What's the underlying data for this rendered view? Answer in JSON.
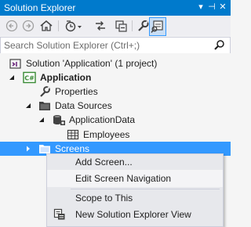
{
  "window": {
    "title": "Solution Explorer",
    "controls": [
      "▾",
      "⊣",
      "✕"
    ]
  },
  "toolbar": {
    "buttons": [
      "back-icon",
      "forward-icon",
      "home-icon",
      "history-icon",
      "sync-icon",
      "properties-icon",
      "preview-icon"
    ]
  },
  "search": {
    "placeholder": "Search Solution Explorer (Ctrl+;)"
  },
  "tree": {
    "solution": "Solution 'Application' (1 project)",
    "project": "Application",
    "properties": "Properties",
    "data_sources": "Data Sources",
    "application_data": "ApplicationData",
    "employees": "Employees",
    "screens": "Screens"
  },
  "context_menu": {
    "items": [
      {
        "label": "Add Screen..."
      },
      {
        "label": "Edit Screen Navigation"
      },
      {
        "label": "Scope to This"
      },
      {
        "label": "New Solution Explorer View"
      }
    ]
  },
  "colors": {
    "accent": "#007acc",
    "selection": "#3399ff"
  }
}
